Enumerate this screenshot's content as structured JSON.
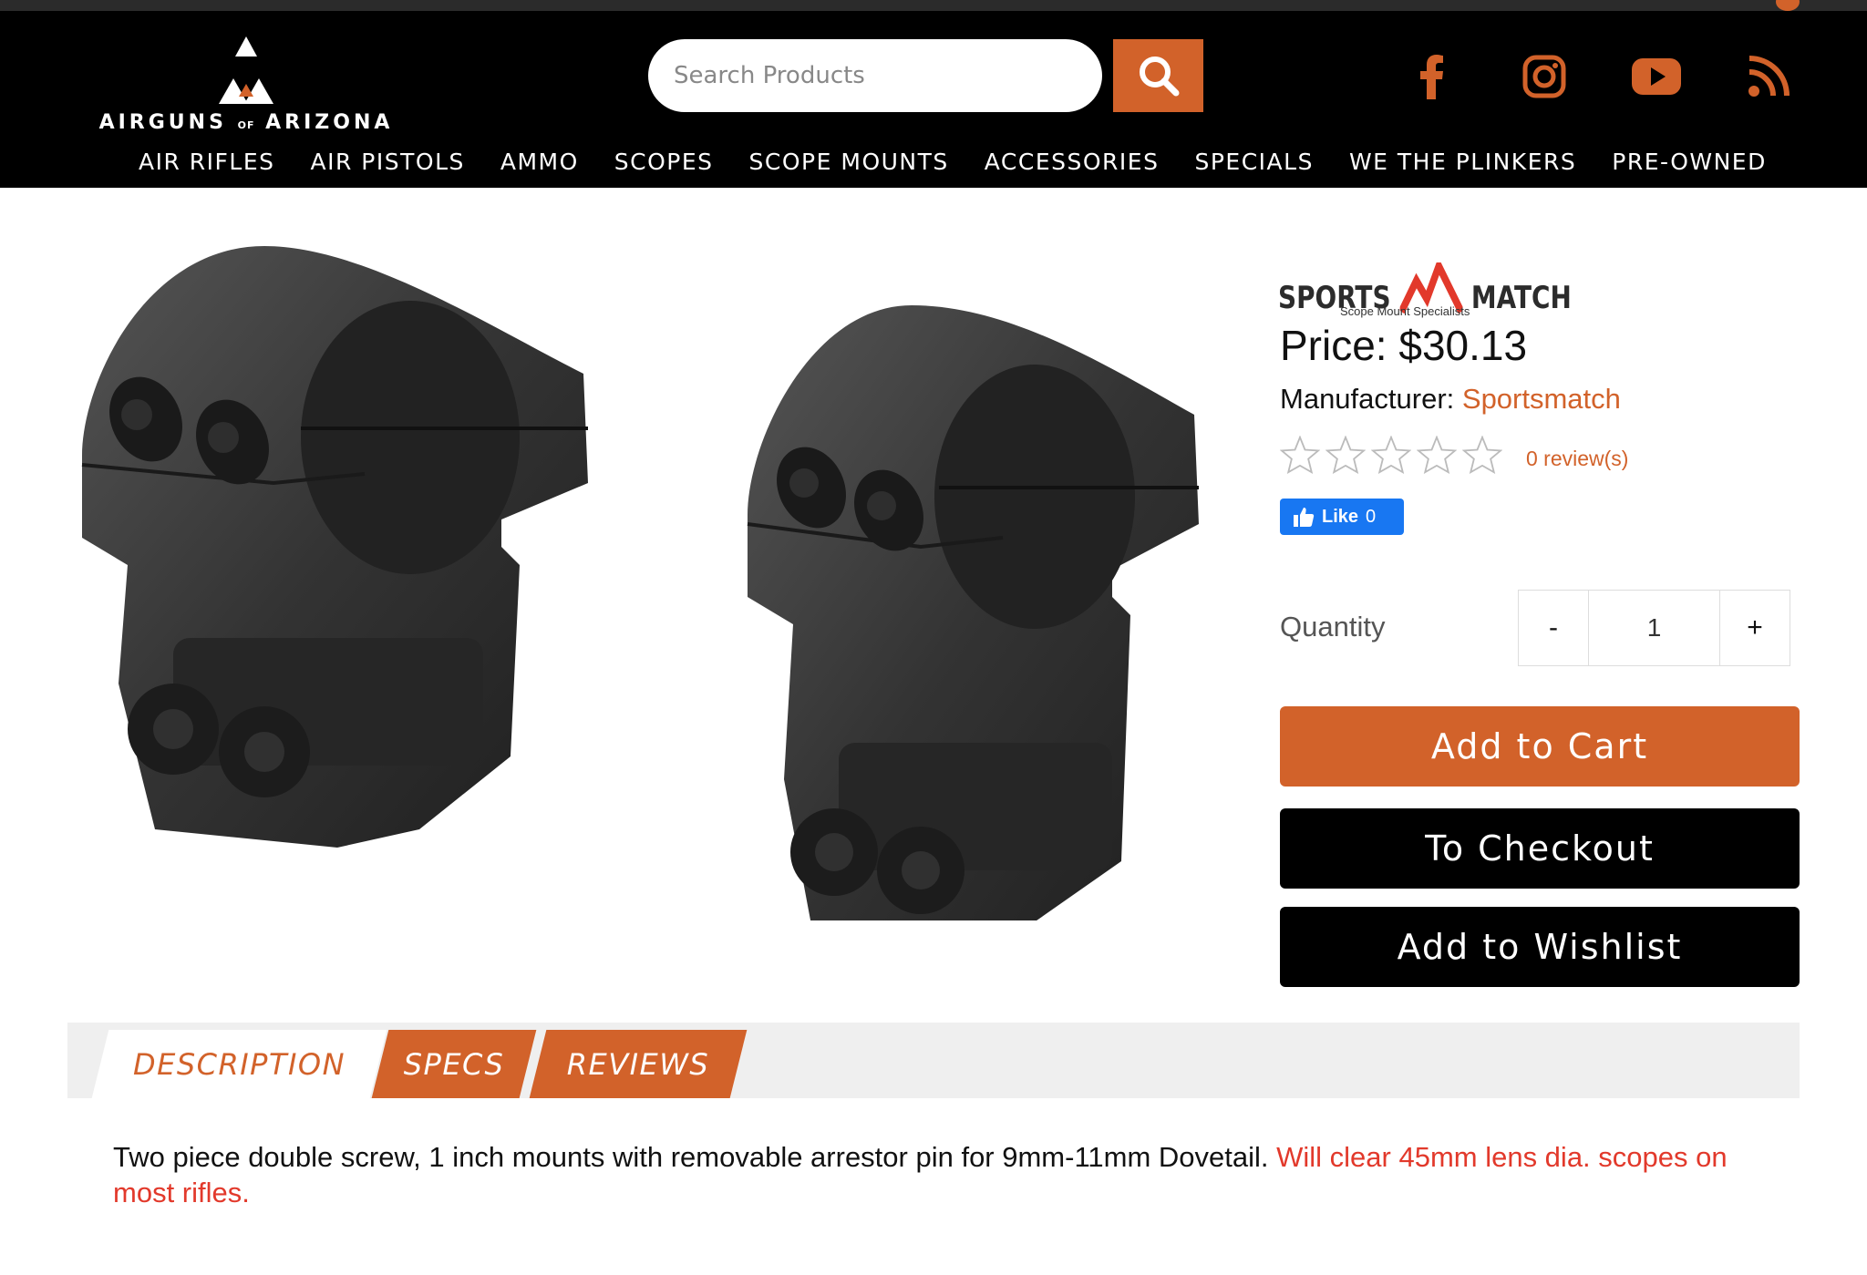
{
  "header": {
    "logo_text": "AIRGUNS",
    "logo_of": "OF",
    "logo_text2": "ARIZONA",
    "search_placeholder": "Search Products",
    "social": [
      "facebook-icon",
      "instagram-icon",
      "youtube-icon",
      "rss-icon"
    ],
    "nav": [
      "AIR RIFLES",
      "AIR PISTOLS",
      "AMMO",
      "SCOPES",
      "SCOPE MOUNTS",
      "ACCESSORIES",
      "SPECIALS",
      "WE THE PLINKERS",
      "PRE-OWNED"
    ]
  },
  "product": {
    "brand_left": "SPORTS",
    "brand_right": "MATCH",
    "brand_tagline": "Scope Mount Specialists",
    "price_label": "Price:",
    "price_value": "$30.13",
    "manufacturer_label": "Manufacturer:",
    "manufacturer_value": "Sportsmatch",
    "rating": 0,
    "reviews": "0 review(s)",
    "like_label": "Like",
    "like_count": "0",
    "quantity_label": "Quantity",
    "quantity_minus": "-",
    "quantity_value": "1",
    "quantity_plus": "+",
    "add_to_cart": "Add to Cart",
    "to_checkout": "To Checkout",
    "add_to_wishlist": "Add to Wishlist"
  },
  "tabs": [
    "DESCRIPTION",
    "SPECS",
    "REVIEWS"
  ],
  "description": {
    "text": "Two piece double screw, 1 inch mounts with removable arrestor pin for 9mm-11mm Dovetail. ",
    "highlight": "Will clear 45mm lens dia. scopes on most rifles."
  },
  "colors": {
    "accent": "#d2622a",
    "header_bg": "#000000",
    "highlight_red": "#e2392b",
    "fb_blue": "#1877f2"
  }
}
